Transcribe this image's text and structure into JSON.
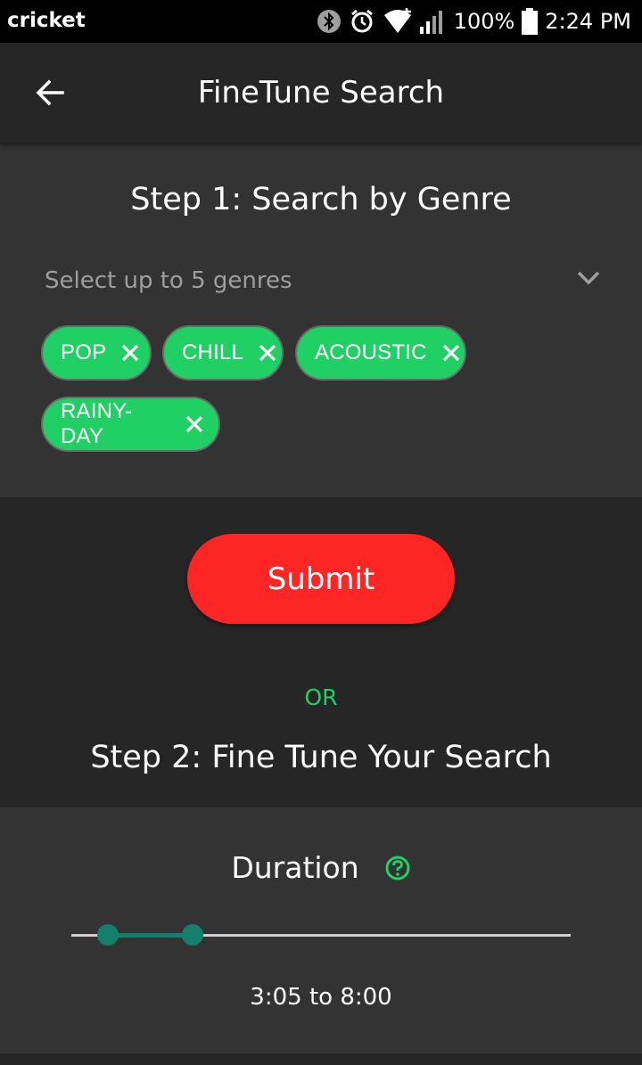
{
  "status_bar": {
    "carrier": "cricket",
    "battery_percent": "100%",
    "time": "2:24 PM",
    "icons": [
      "bluetooth-icon",
      "alarm-icon",
      "wifi-icon",
      "signal-icon",
      "battery-icon"
    ]
  },
  "app_bar": {
    "title": "FineTune Search",
    "back_icon": "arrow-left-icon"
  },
  "step1": {
    "title": "Step 1: Search by Genre",
    "select_placeholder": "Select up to 5 genres",
    "chips": [
      {
        "label": "POP"
      },
      {
        "label": "CHILL"
      },
      {
        "label": "ACOUSTIC"
      },
      {
        "label": "RAINY-DAY"
      }
    ]
  },
  "submit": {
    "label": "Submit"
  },
  "or_label": "OR",
  "step2": {
    "title": "Step 2: Fine Tune Your Search"
  },
  "duration": {
    "title": "Duration",
    "help_icon": "question-circle-icon",
    "range_text": "3:05 to 8:00",
    "min_value_fraction": 0.052,
    "max_value_fraction": 0.221
  },
  "colors": {
    "accent_green": "#21d064",
    "submit_red": "#fe2525",
    "slider_teal": "#14806b",
    "panel": "#333333",
    "background": "#262626"
  }
}
